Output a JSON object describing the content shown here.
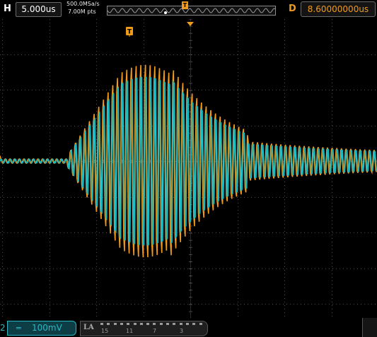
{
  "top_bar": {
    "horizontal_label": "H",
    "timebase": "5.000us",
    "sample_rate": "500.0MSa/s",
    "memory_depth": "7.00M pts",
    "trigger_marker": "T",
    "delay_label": "D",
    "trigger_delay": "8.60000000us"
  },
  "scope": {
    "trigger_marker": "T",
    "colors": {
      "grid": "#4a4a4a",
      "channel_1": "#f29a1b",
      "channel_2": "#17b5bd",
      "marker": "#f29a1b"
    }
  },
  "bottom_bar": {
    "channel_number": "2",
    "coupling_symbol": "═",
    "vertical_scale": "100mV",
    "la_label": "LA",
    "la_channel_labels": [
      "15",
      "11",
      "7",
      "3"
    ]
  }
}
